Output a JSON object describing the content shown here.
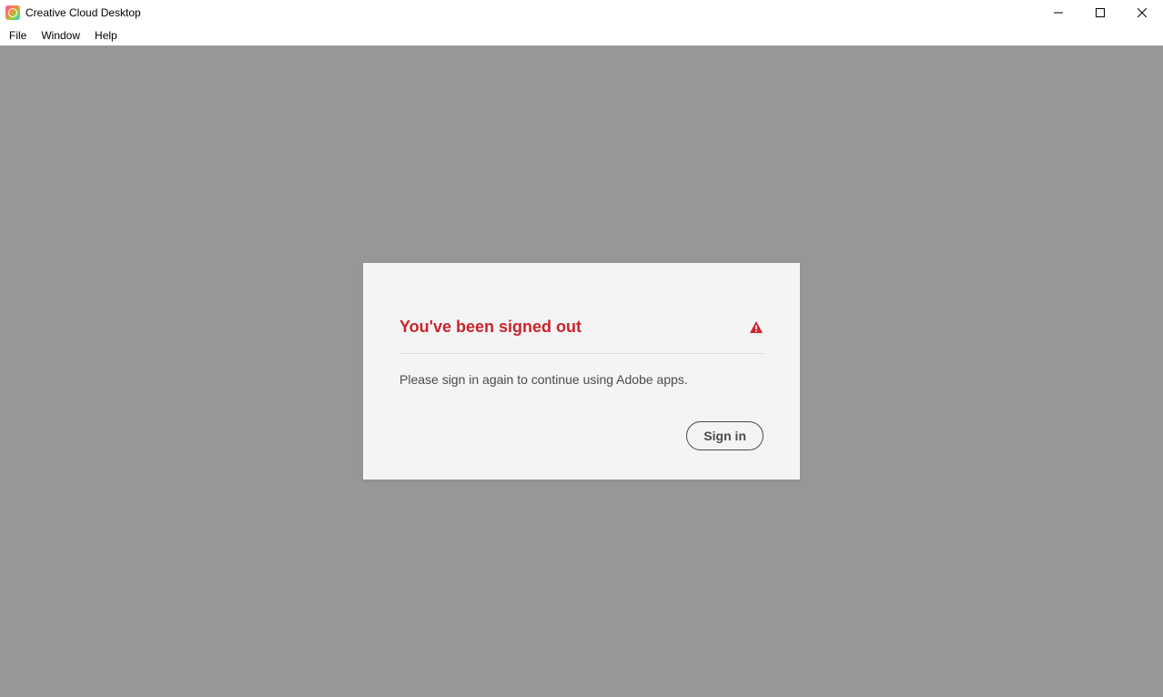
{
  "window": {
    "title": "Creative Cloud Desktop"
  },
  "menubar": {
    "items": [
      "File",
      "Window",
      "Help"
    ]
  },
  "dialog": {
    "title": "You've been signed out",
    "message": "Please sign in again to continue using Adobe apps.",
    "button_label": "Sign in"
  },
  "colors": {
    "accent": "#c9252d",
    "content_bg": "#979797",
    "dialog_bg": "#f4f4f4"
  }
}
